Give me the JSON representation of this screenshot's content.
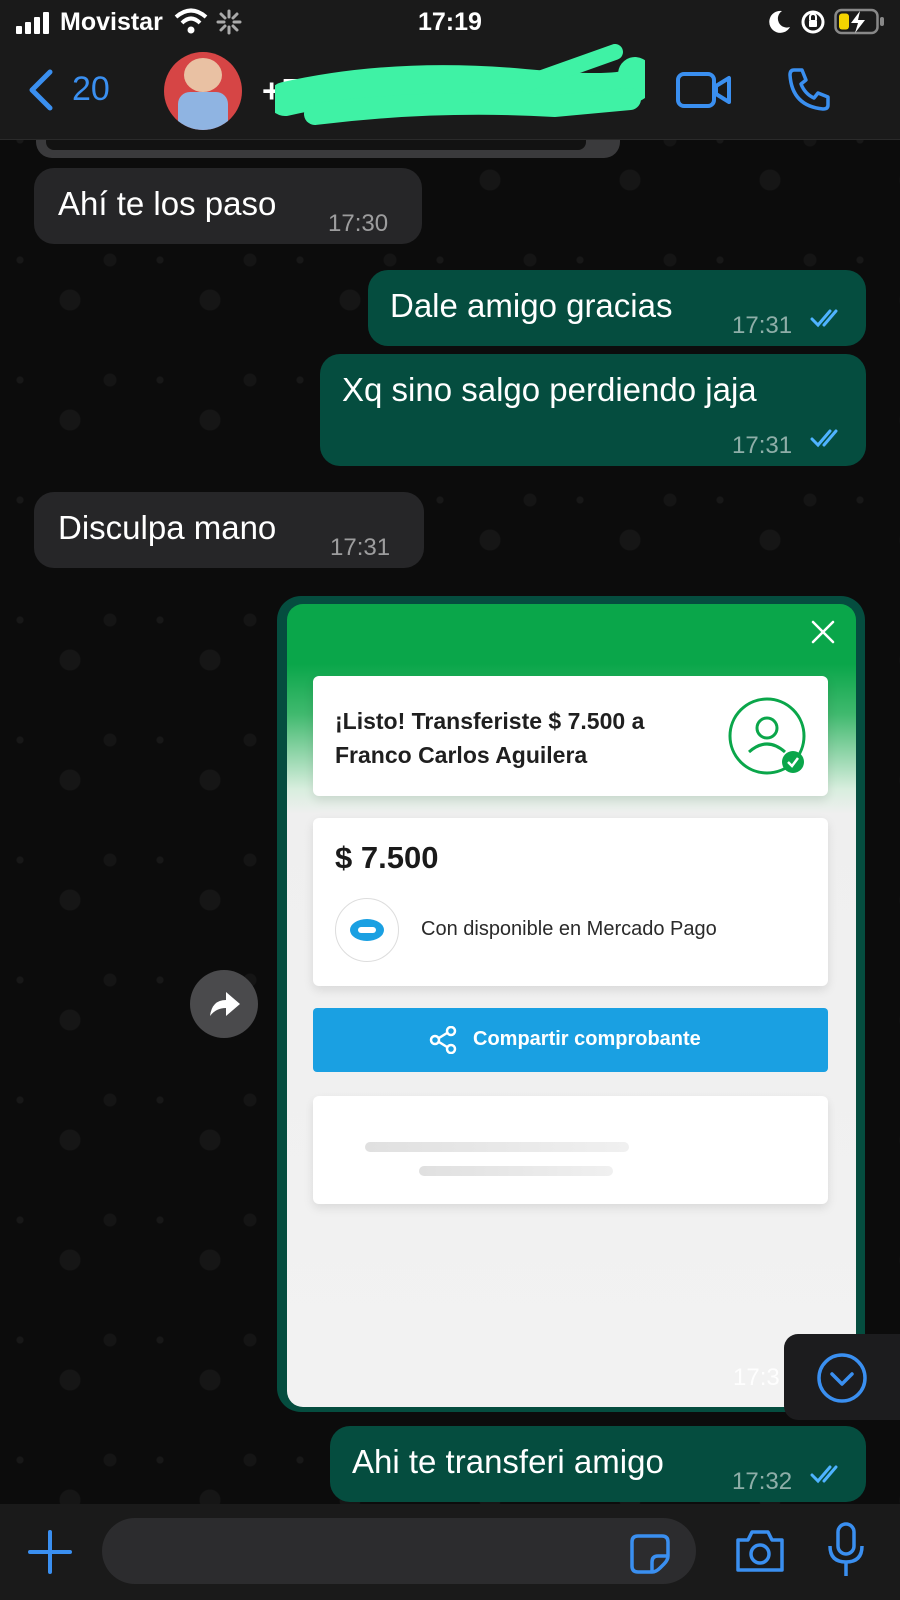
{
  "status_bar": {
    "carrier": "Movistar",
    "time": "17:19"
  },
  "header": {
    "back_count": "20",
    "contact_prefix": "+5"
  },
  "messages": [
    {
      "direction": "in",
      "text": "Ahí te los paso",
      "time": "17:30"
    },
    {
      "direction": "out",
      "text": "Dale amigo gracias",
      "time": "17:31",
      "status": "read"
    },
    {
      "direction": "out",
      "text": "Xq sino salgo perdiendo jaja",
      "time": "17:31",
      "status": "read"
    },
    {
      "direction": "in",
      "text": "Disculpa mano",
      "time": "17:31"
    },
    {
      "direction": "out",
      "type": "image",
      "time": "17:3"
    },
    {
      "direction": "out",
      "text": "Ahi te transferi amigo",
      "time": "17:32",
      "status": "read"
    }
  ],
  "receipt": {
    "title": "¡Listo! Transferiste $ 7.500 a Franco Carlos Aguilera",
    "amount": "$ 7.500",
    "source": "Con disponible en Mercado Pago",
    "share_button": "Compartir comprobante",
    "brand_color": "#0aa64a",
    "button_color": "#1aa0e2"
  },
  "colors": {
    "outgoing_bubble": "#054d3f",
    "incoming_bubble": "#262628",
    "accent": "#3a8ff0",
    "read_ticks": "#4fb3ff",
    "redaction": "#3ff2a5"
  },
  "icons": {
    "back": "chevron-left-icon",
    "video": "video-camera-icon",
    "call": "phone-icon",
    "forward": "forward-arrow-icon",
    "scroll_down": "chevron-down-circle-icon",
    "add": "plus-icon",
    "sticker": "sticker-icon",
    "camera": "camera-icon",
    "mic": "microphone-icon"
  }
}
